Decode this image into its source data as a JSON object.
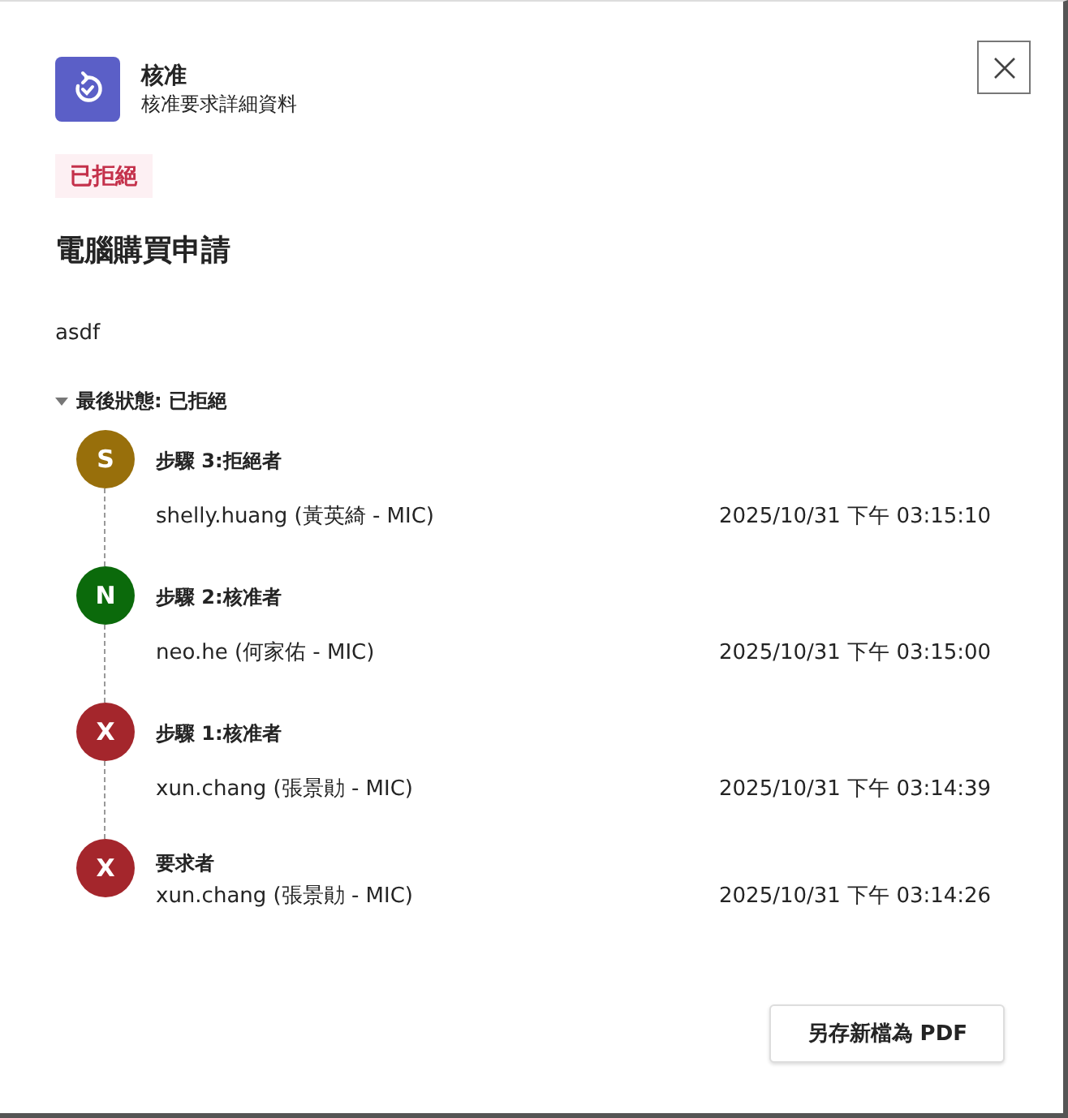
{
  "header": {
    "title": "核准",
    "subtitle": "核准要求詳細資料"
  },
  "status_badge": "已拒絕",
  "request_title": "電腦購買申請",
  "description": "asdf",
  "history": {
    "label": "最後狀態: 已拒絕",
    "expanded": true,
    "items": [
      {
        "kind": "step",
        "initial": "S",
        "color": "#986f0b",
        "label": "步驟 3:拒絕者",
        "name": "shelly.huang (黃英綺 - MIC)",
        "time": "2025/10/31 下午 03:15:10"
      },
      {
        "kind": "step",
        "initial": "N",
        "color": "#0b6a0b",
        "label": "步驟 2:核准者",
        "name": "neo.he (何家佑 - MIC)",
        "time": "2025/10/31 下午 03:15:00"
      },
      {
        "kind": "step",
        "initial": "X",
        "color": "#a4262c",
        "label": "步驟 1:核准者",
        "name": "xun.chang (張景勛 - MIC)",
        "time": "2025/10/31 下午 03:14:39"
      },
      {
        "kind": "requester",
        "initial": "X",
        "color": "#a4262c",
        "label": "要求者",
        "name": "xun.chang (張景勛 - MIC)",
        "time": "2025/10/31 下午 03:14:26"
      }
    ]
  },
  "save_button": "另存新檔為 PDF"
}
